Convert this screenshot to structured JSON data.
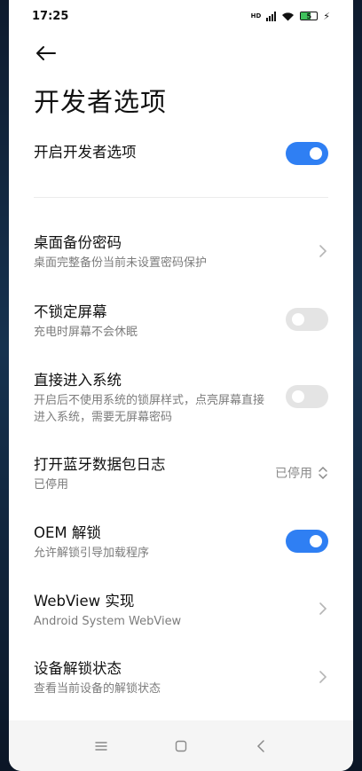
{
  "status": {
    "time": "17:25",
    "hd": "HD",
    "battery": "5"
  },
  "page": {
    "title": "开发者选项"
  },
  "items": [
    {
      "title": "开启开发者选项"
    },
    {
      "title": "桌面备份密码",
      "subtitle": "桌面完整备份当前未设置密码保护"
    },
    {
      "title": "不锁定屏幕",
      "subtitle": "充电时屏幕不会休眠"
    },
    {
      "title": "直接进入系统",
      "subtitle": "开启后不使用系统的锁屏样式，点亮屏幕直接进入系统，需要无屏幕密码"
    },
    {
      "title": "打开蓝牙数据包日志",
      "subtitle": "已停用",
      "value": "已停用"
    },
    {
      "title": "OEM 解锁",
      "subtitle": "允许解锁引导加载程序"
    },
    {
      "title": "WebView 实现",
      "subtitle": "Android System WebView"
    },
    {
      "title": "设备解锁状态",
      "subtitle": "查看当前设备的解锁状态"
    }
  ],
  "toggles": {
    "developer_options": true,
    "stay_awake": false,
    "direct_boot": false,
    "oem_unlock": true
  },
  "colors": {
    "accent": "#2f7ff3",
    "toggle_off": "#e4e4e4",
    "subtext": "#7c7c7c"
  }
}
